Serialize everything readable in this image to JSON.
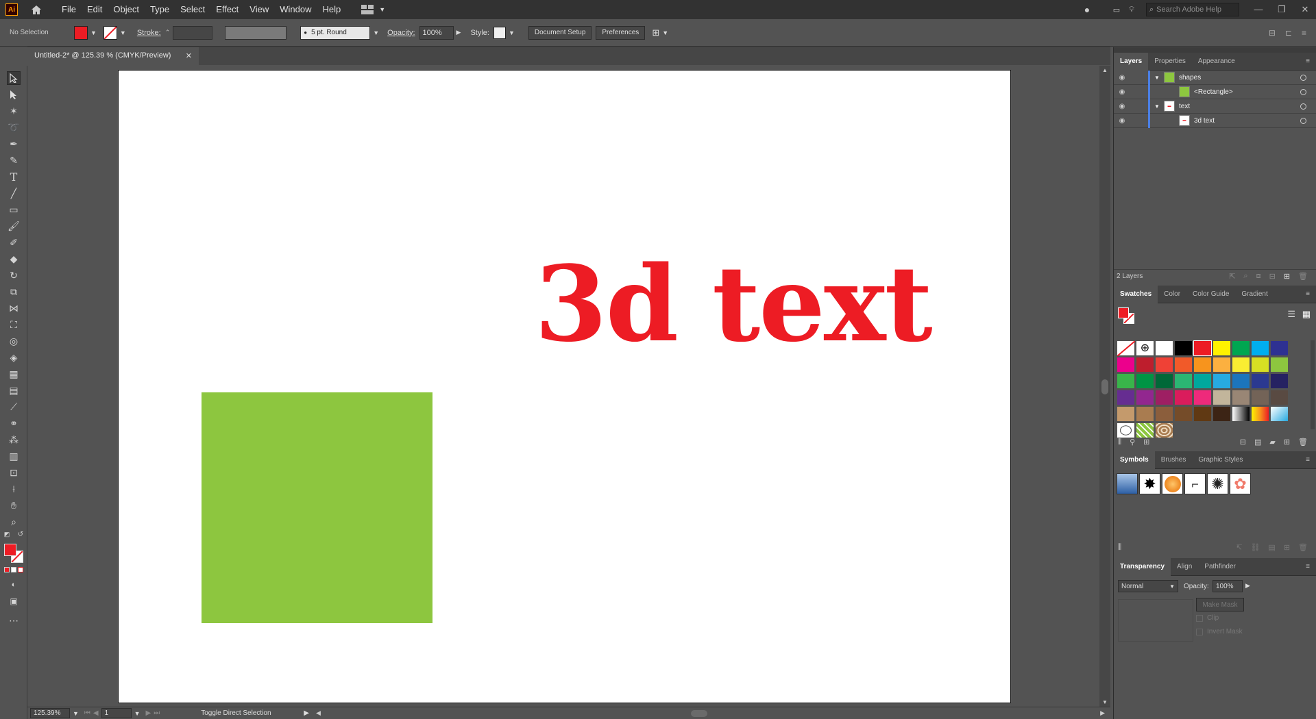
{
  "menubar": {
    "logo": "Ai",
    "items": [
      "File",
      "Edit",
      "Object",
      "Type",
      "Select",
      "Effect",
      "View",
      "Window",
      "Help"
    ],
    "search_placeholder": "Search Adobe Help"
  },
  "control": {
    "selection": "No Selection",
    "stroke_label": "Stroke:",
    "brush": "5 pt. Round",
    "opacity_label": "Opacity:",
    "opacity_value": "100%",
    "style_label": "Style:",
    "doc_setup": "Document Setup",
    "preferences": "Preferences",
    "fill_color": "#ed1c24"
  },
  "document": {
    "tab_title": "Untitled-2* @ 125.39 % (CMYK/Preview)",
    "art_text": "3d text",
    "text_color": "#ed1c24",
    "rect_color": "#8dc63f"
  },
  "status": {
    "zoom": "125.39%",
    "artboard": "1",
    "message": "Toggle Direct Selection"
  },
  "layers": {
    "tabs": [
      "Layers",
      "Properties",
      "Appearance"
    ],
    "rows": [
      {
        "name": "shapes",
        "thumb": "green"
      },
      {
        "name": "<Rectangle>",
        "thumb": "green"
      },
      {
        "name": "text",
        "thumb": "text"
      },
      {
        "name": "3d text",
        "thumb": "text"
      }
    ],
    "count": "2 Layers"
  },
  "swatches": {
    "tabs": [
      "Swatches",
      "Color",
      "Color Guide",
      "Gradient"
    ],
    "colors": [
      "none",
      "reg",
      "#ffffff",
      "#000000",
      "#ed1c24",
      "#fff200",
      "#00a651",
      "#00aeef",
      "#2e3192",
      "#ec008c",
      "#be1e2d",
      "#ef4136",
      "#f15a29",
      "#f7941d",
      "#fbb040",
      "#f9ed32",
      "#d7df23",
      "#8dc63f",
      "#39b54a",
      "#009444",
      "#006838",
      "#2bb673",
      "#00a79d",
      "#27aae1",
      "#1c75bc",
      "#2b3990",
      "#262262",
      "#662d91",
      "#92278f",
      "#9e1f63",
      "#da1c5c",
      "#ee2a7b",
      "#c2b59b",
      "#998675",
      "#736357",
      "#594a42",
      "#c49a6c",
      "#a97c50",
      "#8b5e3c",
      "#754c29",
      "#603913",
      "#3c2415",
      "grad1",
      "grad2",
      "grad3"
    ]
  },
  "symbols": {
    "tabs": [
      "Symbols",
      "Brushes",
      "Graphic Styles"
    ]
  },
  "transparency": {
    "tabs": [
      "Transparency",
      "Align",
      "Pathfinder"
    ],
    "mode": "Normal",
    "opacity_label": "Opacity:",
    "opacity": "100%",
    "make_mask": "Make Mask",
    "clip": "Clip",
    "invert": "Invert Mask"
  }
}
